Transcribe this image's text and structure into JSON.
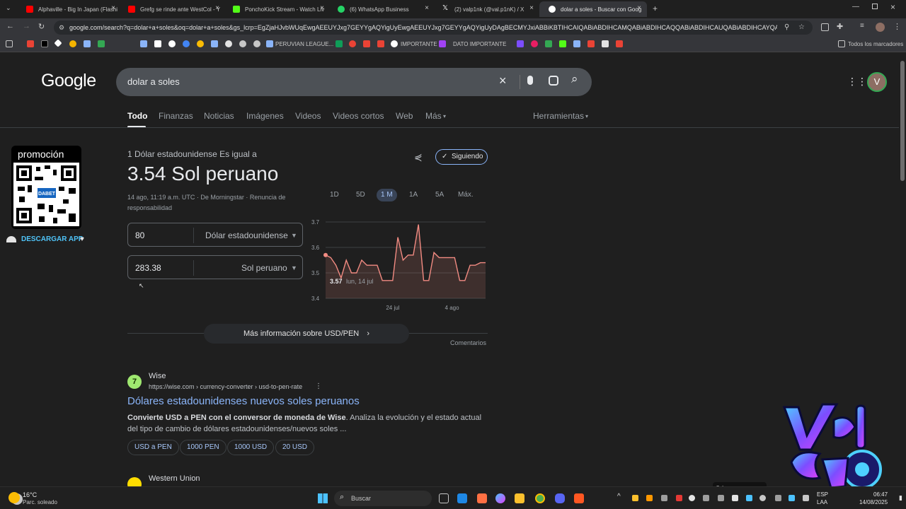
{
  "tabs": [
    {
      "title": "Alphaville - Big In Japan (Flashi",
      "color": "#ff0000"
    },
    {
      "title": "Grefg se rinde ante WestCol - Y",
      "color": "#ff0000"
    },
    {
      "title": "PonchoKick Stream - Watch Liv",
      "color": "#53fc18"
    },
    {
      "title": "(6) WhatsApp Business",
      "color": "#25d366"
    },
    {
      "title": "(2) valp1nk (@val.p1nK) / X",
      "color": "#ffffff"
    },
    {
      "title": "dolar a soles - Buscar con Goog",
      "color": "#4285f4"
    }
  ],
  "address": {
    "url": "google.com/search?q=dolar+a+soles&oq=dolar+a+soles&gs_lcrp=EgZjaHJvbWUqEwgAEEUYJxg7GEYYgAQYigUyEwgAEEUYJxg7GEYYgAQYigUyDAgBECMYJxiABBiKBTIHCAIQABiABDIHCAMQABiABDIHCAQQABiABDIHCAUQABiABDIHCAYQABiABDIHC..."
  },
  "bookmarks": {
    "peruvian": "PERUVIAN LEAGUE...",
    "importante": "IMPORTANTE",
    "dato": "DATO IMPORTANTE",
    "all": "Todos los marcadores"
  },
  "google": {
    "logo": "Google",
    "query": "dolar a soles",
    "account_initial": "V",
    "nav": [
      "Todo",
      "Finanzas",
      "Noticias",
      "Imágenes",
      "Videos",
      "Videos cortos",
      "Web",
      "Más"
    ],
    "tools": "Herramientas"
  },
  "promo": {
    "title": "promoción",
    "brand": "DABET",
    "app": "DESCARGAR APP"
  },
  "converter": {
    "header": "1 Dólar estadounidense Es igual a",
    "result": "3.54 Sol peruano",
    "follow": "Siguiendo",
    "meta1": "14 ago, 11:19 a.m. UTC · De Morningstar · Renuncia de",
    "meta2": "responsabilidad",
    "amount_from": "80",
    "currency_from": "Dólar estadounidense",
    "amount_to": "283.38",
    "currency_to": "Sol peruano",
    "ranges": [
      "1D",
      "5D",
      "1 M",
      "1A",
      "5A",
      "Máx."
    ],
    "active_range": "1 M",
    "more_info": "Más información sobre USD/PEN",
    "feedback": "Comentarios"
  },
  "chart_data": {
    "type": "line",
    "y_ticks": [
      "3.7",
      "3.6",
      "3.5",
      "3.4"
    ],
    "x_ticks": [
      "24 jul",
      "4 ago"
    ],
    "ylim": [
      3.4,
      3.7
    ],
    "tooltip_value": "3.57",
    "tooltip_date": "lun, 14 jul",
    "values": [
      3.57,
      3.56,
      3.53,
      3.48,
      3.55,
      3.5,
      3.5,
      3.55,
      3.53,
      3.53,
      3.53,
      3.47,
      3.47,
      3.47,
      3.64,
      3.55,
      3.57,
      3.57,
      3.69,
      3.47,
      3.47,
      3.58,
      3.56,
      3.56,
      3.56,
      3.56,
      3.47,
      3.47,
      3.53,
      3.53,
      3.54,
      3.54
    ],
    "color": "#f28b82"
  },
  "result": {
    "site": "Wise",
    "url": "https://wise.com › currency-converter › usd-to-pen-rate",
    "title": "Dólares estadounidenses nuevos soles peruanos",
    "snippet_bold": "Convierte USD a PEN con el conversor de moneda de Wise",
    "snippet_rest": ". Analiza la evolución y el estado actual",
    "snippet_line2": "del tipo de cambio de dólares estadounidenses/nuevos soles ...",
    "chips": [
      "USD a PEN",
      "1000 PEN",
      "1000 USD",
      "20 USD"
    ],
    "next_site": "Western Union"
  },
  "overlay": {
    "badge": "valp1nk"
  },
  "taskbar": {
    "temp": "16°C",
    "weather": "Parc. soleado",
    "search": "Buscar",
    "lang1": "ESP",
    "lang2": "LAA",
    "time": "06:47",
    "date": "14/08/2025"
  }
}
